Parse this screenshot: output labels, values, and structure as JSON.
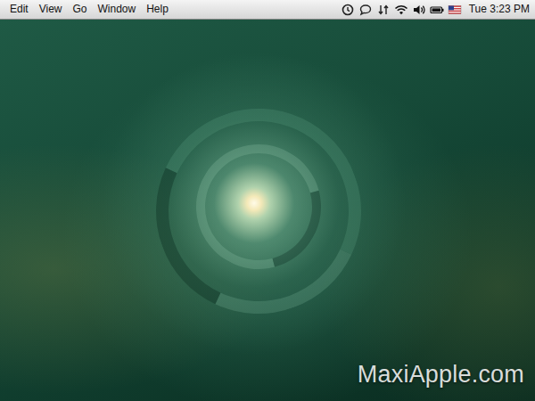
{
  "menubar": {
    "menus": [
      "Edit",
      "View",
      "Go",
      "Window",
      "Help"
    ],
    "clock": "Tue 3:23 PM"
  },
  "watermark": "MaxiApple.com"
}
